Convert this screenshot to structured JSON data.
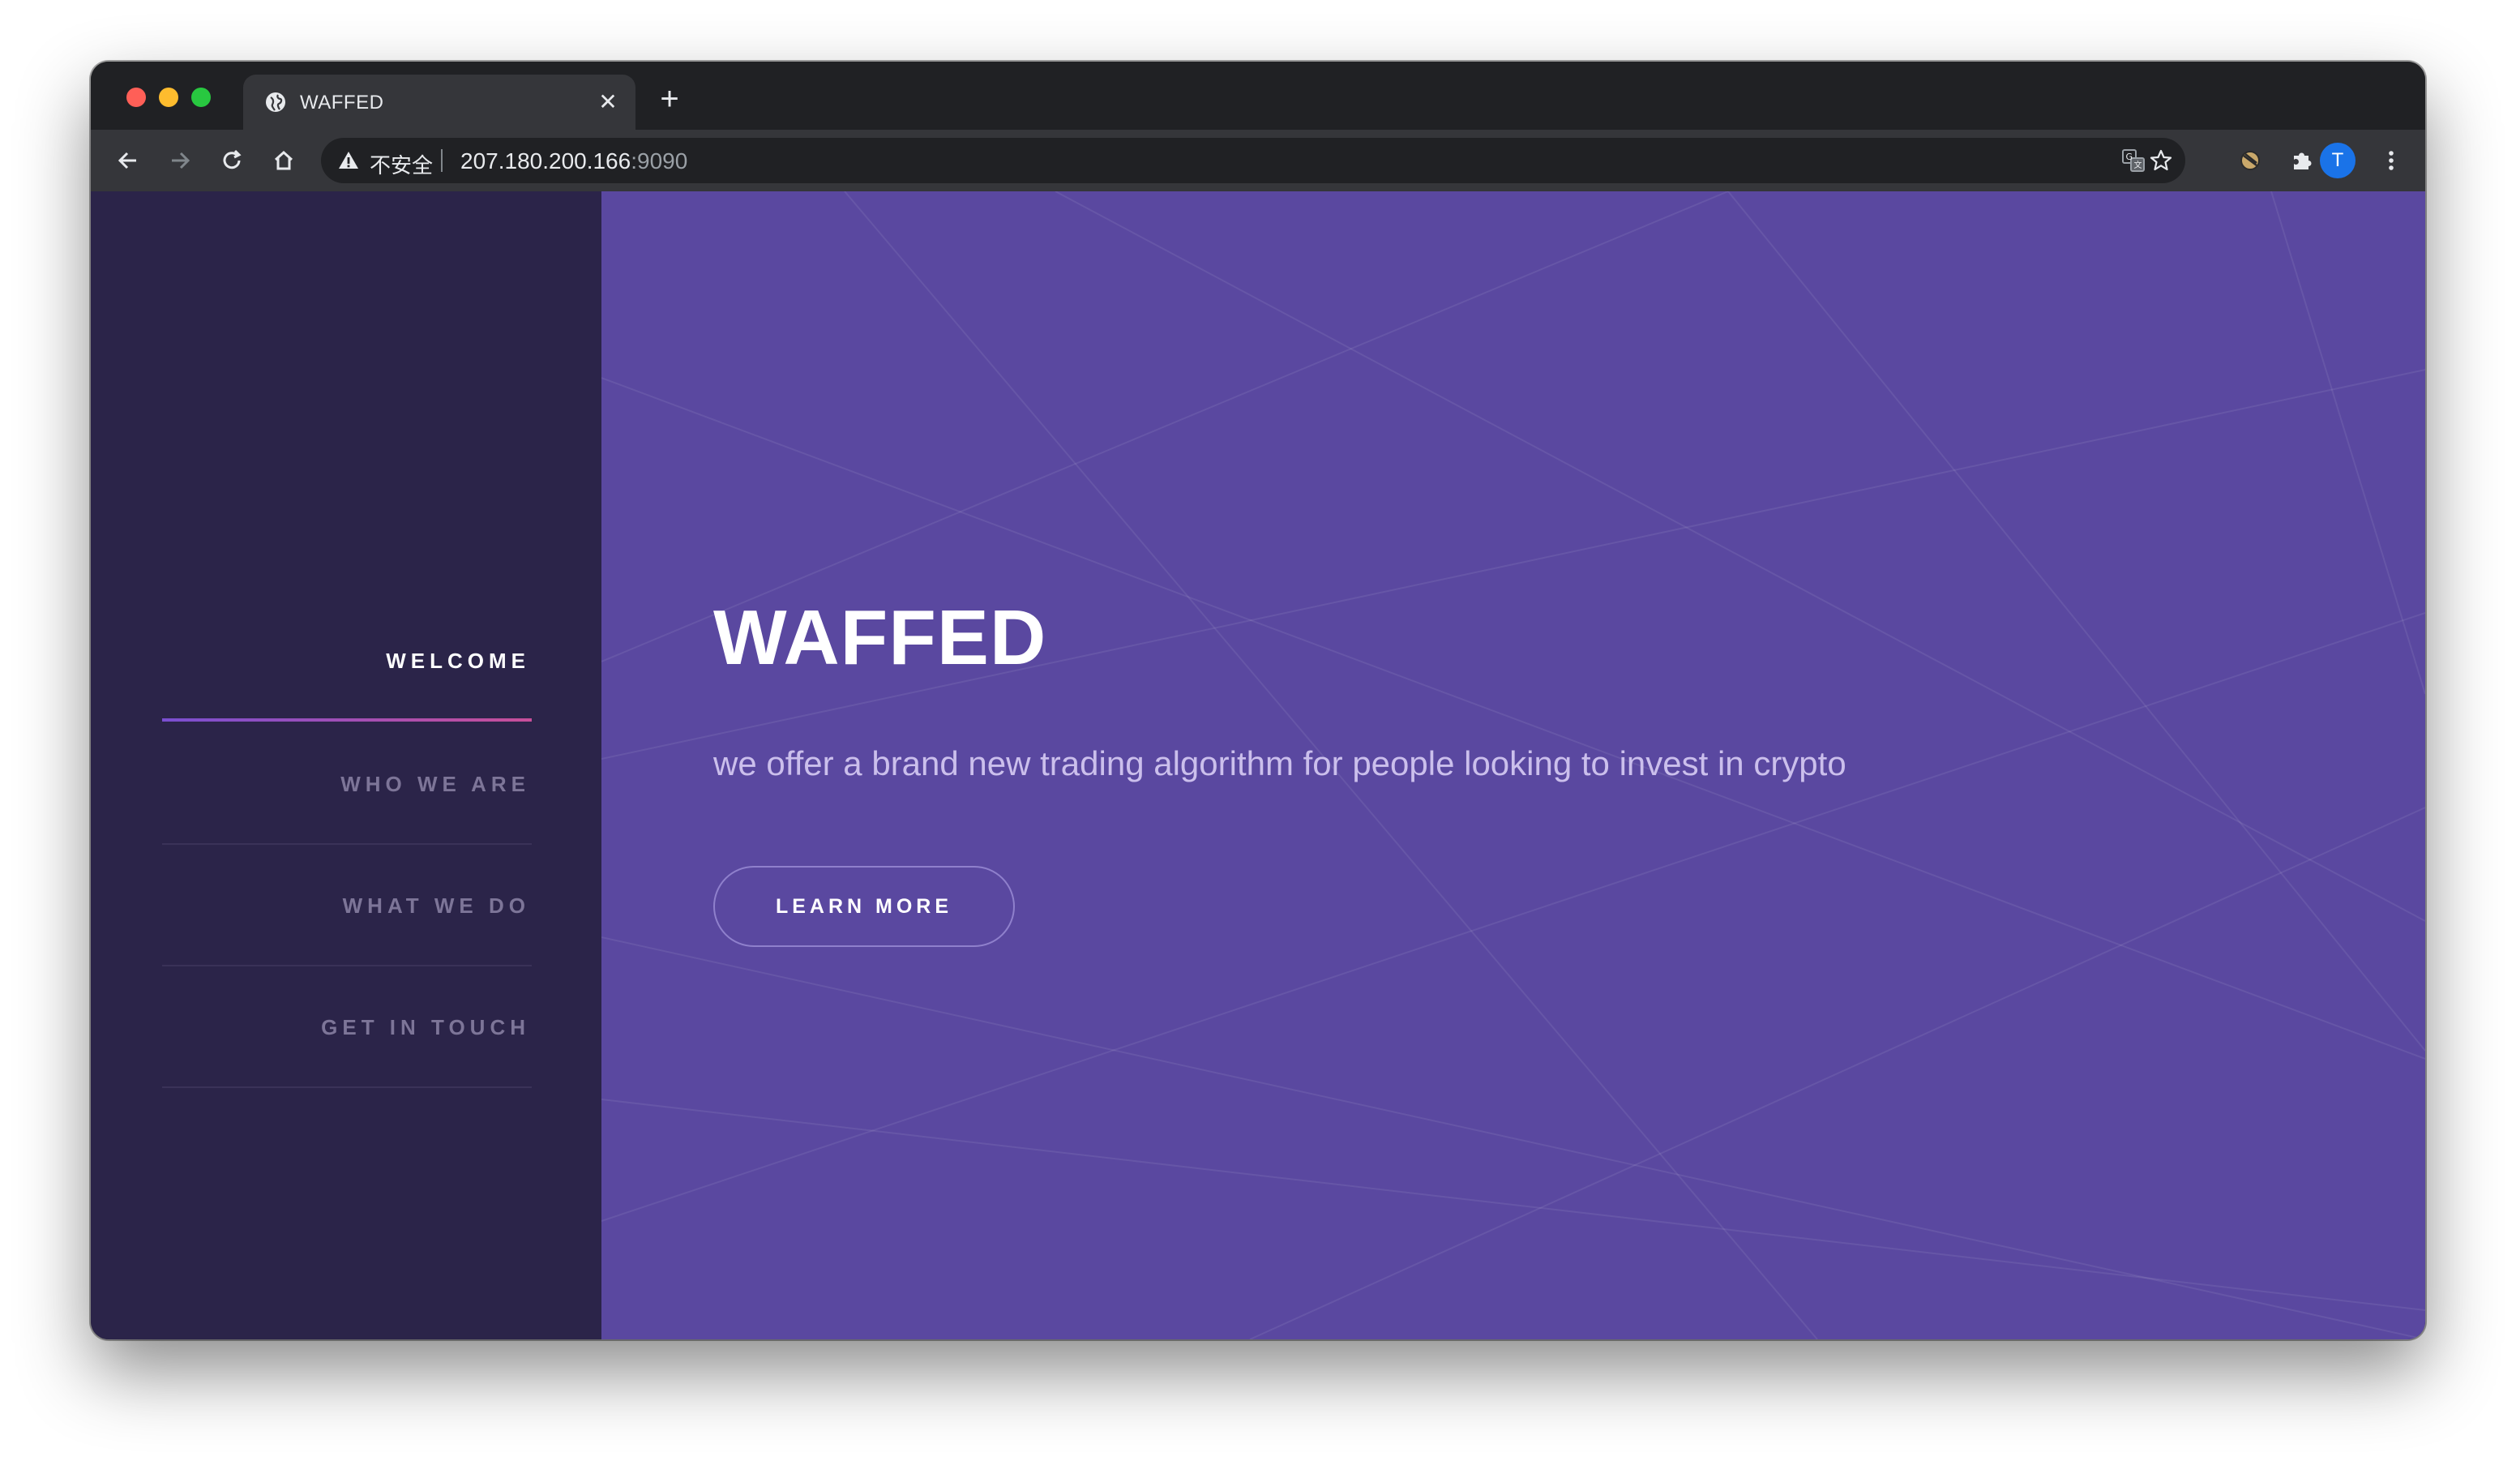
{
  "browser": {
    "tab": {
      "title": "WAFFED",
      "close_glyph": "✕",
      "new_tab_glyph": "+"
    },
    "omnibox": {
      "security_label": "不安全",
      "host": "207.180.200.166",
      "port": ":9090"
    },
    "profile_initial": "T",
    "icons": [
      "back-icon",
      "forward-icon",
      "reload-icon",
      "home-icon",
      "warning-icon",
      "translate-icon",
      "bookmark-star-icon",
      "extension-icon",
      "puzzle-icon",
      "more-icon"
    ]
  },
  "sidebar": {
    "items": [
      {
        "label": "WELCOME",
        "active": true
      },
      {
        "label": "WHO WE ARE",
        "active": false
      },
      {
        "label": "WHAT WE DO",
        "active": false
      },
      {
        "label": "GET IN TOUCH",
        "active": false
      }
    ]
  },
  "hero": {
    "title": "WAFFED",
    "subtitle": "we offer a brand new trading algorithm for people looking to invest in crypto",
    "button_label": "LEARN MORE"
  },
  "colors": {
    "sidebar_bg": "#2b2449",
    "main_bg": "#5a48a0",
    "accent_gradient_start": "#7a4fd1",
    "accent_gradient_end": "#c84f9a"
  }
}
